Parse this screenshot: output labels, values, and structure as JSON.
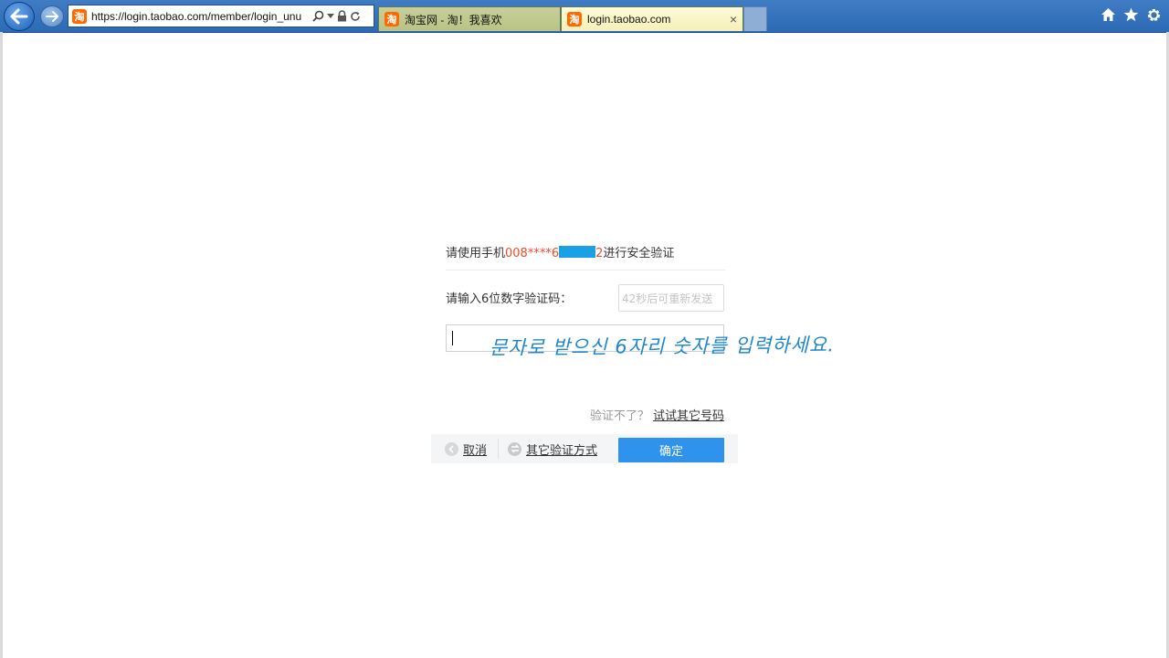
{
  "browser": {
    "address_url": "https://login.taobao.com/member/login_unu",
    "favicon_glyph": "淘",
    "tabs": [
      {
        "title": "淘宝网 - 淘！我喜欢",
        "active": false
      },
      {
        "title": "login.taobao.com",
        "active": true
      }
    ],
    "tab_close": "×",
    "accent_color": "#2d6ab6"
  },
  "verify": {
    "line1_prefix": "请使用手机",
    "phone_masked": "008****6",
    "phone_suffix": "2",
    "line1_suffix": "进行安全验证",
    "code_label": "请输入6位数字验证码：",
    "resend_label": "42秒后可重新发送",
    "annotation": "문자로 받으신 6자리 숫자를 입력하세요.",
    "help_question": "验证不了？",
    "help_link": "试试其它号码"
  },
  "actions": {
    "cancel_label": "取消",
    "other_method_label": "其它验证方式",
    "confirm_label": "确定",
    "confirm_color": "#2f93ee"
  }
}
